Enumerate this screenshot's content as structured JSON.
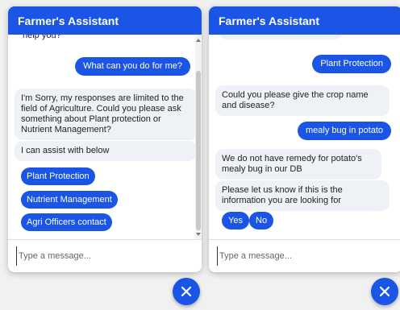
{
  "colors": {
    "accent": "#1a55e6",
    "bot_bubble": "#eef1f5",
    "background": "#f1f1f1"
  },
  "left_panel": {
    "title": "Farmer's Assistant",
    "partial_top": "help you?",
    "user_message": "What can you do for me?",
    "bot_message": "I'm Sorry, my responses are limited to the field of Agriculture. Could you please ask something about Plant protection or Nutrient Management?",
    "bot_assist": "I can assist with below",
    "options": [
      "Plant Protection",
      "Nutrient Management",
      "Agri Officers contact"
    ],
    "input_placeholder": "Type a message...",
    "close_icon": "close-icon"
  },
  "right_panel": {
    "title": "Farmer's Assistant",
    "user_message_1": "Plant Protection",
    "bot_message_1": "Could you please give the crop name and disease?",
    "user_message_2": "mealy bug in potato",
    "bot_message_2": "We do not have remedy for potato's mealy bug in our DB",
    "bot_message_3": "Please let us know if this is the information you are looking for",
    "options": [
      "Yes",
      "No"
    ],
    "input_placeholder": "Type a message...",
    "close_icon": "close-icon"
  }
}
